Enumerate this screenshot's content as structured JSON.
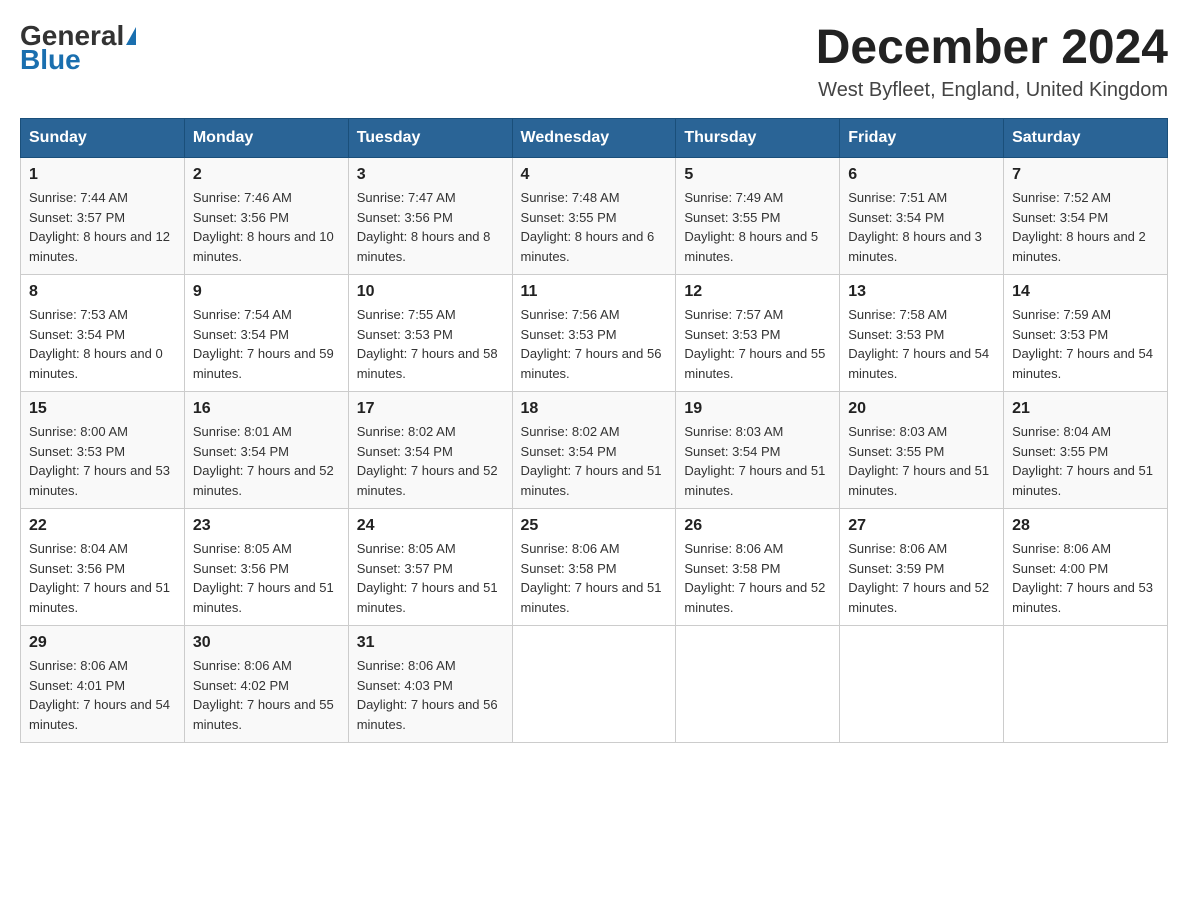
{
  "logo": {
    "general": "General",
    "blue": "Blue"
  },
  "header": {
    "month_year": "December 2024",
    "location": "West Byfleet, England, United Kingdom"
  },
  "days_of_week": [
    "Sunday",
    "Monday",
    "Tuesday",
    "Wednesday",
    "Thursday",
    "Friday",
    "Saturday"
  ],
  "weeks": [
    [
      {
        "day": "1",
        "sunrise": "7:44 AM",
        "sunset": "3:57 PM",
        "daylight": "8 hours and 12 minutes."
      },
      {
        "day": "2",
        "sunrise": "7:46 AM",
        "sunset": "3:56 PM",
        "daylight": "8 hours and 10 minutes."
      },
      {
        "day": "3",
        "sunrise": "7:47 AM",
        "sunset": "3:56 PM",
        "daylight": "8 hours and 8 minutes."
      },
      {
        "day": "4",
        "sunrise": "7:48 AM",
        "sunset": "3:55 PM",
        "daylight": "8 hours and 6 minutes."
      },
      {
        "day": "5",
        "sunrise": "7:49 AM",
        "sunset": "3:55 PM",
        "daylight": "8 hours and 5 minutes."
      },
      {
        "day": "6",
        "sunrise": "7:51 AM",
        "sunset": "3:54 PM",
        "daylight": "8 hours and 3 minutes."
      },
      {
        "day": "7",
        "sunrise": "7:52 AM",
        "sunset": "3:54 PM",
        "daylight": "8 hours and 2 minutes."
      }
    ],
    [
      {
        "day": "8",
        "sunrise": "7:53 AM",
        "sunset": "3:54 PM",
        "daylight": "8 hours and 0 minutes."
      },
      {
        "day": "9",
        "sunrise": "7:54 AM",
        "sunset": "3:54 PM",
        "daylight": "7 hours and 59 minutes."
      },
      {
        "day": "10",
        "sunrise": "7:55 AM",
        "sunset": "3:53 PM",
        "daylight": "7 hours and 58 minutes."
      },
      {
        "day": "11",
        "sunrise": "7:56 AM",
        "sunset": "3:53 PM",
        "daylight": "7 hours and 56 minutes."
      },
      {
        "day": "12",
        "sunrise": "7:57 AM",
        "sunset": "3:53 PM",
        "daylight": "7 hours and 55 minutes."
      },
      {
        "day": "13",
        "sunrise": "7:58 AM",
        "sunset": "3:53 PM",
        "daylight": "7 hours and 54 minutes."
      },
      {
        "day": "14",
        "sunrise": "7:59 AM",
        "sunset": "3:53 PM",
        "daylight": "7 hours and 54 minutes."
      }
    ],
    [
      {
        "day": "15",
        "sunrise": "8:00 AM",
        "sunset": "3:53 PM",
        "daylight": "7 hours and 53 minutes."
      },
      {
        "day": "16",
        "sunrise": "8:01 AM",
        "sunset": "3:54 PM",
        "daylight": "7 hours and 52 minutes."
      },
      {
        "day": "17",
        "sunrise": "8:02 AM",
        "sunset": "3:54 PM",
        "daylight": "7 hours and 52 minutes."
      },
      {
        "day": "18",
        "sunrise": "8:02 AM",
        "sunset": "3:54 PM",
        "daylight": "7 hours and 51 minutes."
      },
      {
        "day": "19",
        "sunrise": "8:03 AM",
        "sunset": "3:54 PM",
        "daylight": "7 hours and 51 minutes."
      },
      {
        "day": "20",
        "sunrise": "8:03 AM",
        "sunset": "3:55 PM",
        "daylight": "7 hours and 51 minutes."
      },
      {
        "day": "21",
        "sunrise": "8:04 AM",
        "sunset": "3:55 PM",
        "daylight": "7 hours and 51 minutes."
      }
    ],
    [
      {
        "day": "22",
        "sunrise": "8:04 AM",
        "sunset": "3:56 PM",
        "daylight": "7 hours and 51 minutes."
      },
      {
        "day": "23",
        "sunrise": "8:05 AM",
        "sunset": "3:56 PM",
        "daylight": "7 hours and 51 minutes."
      },
      {
        "day": "24",
        "sunrise": "8:05 AM",
        "sunset": "3:57 PM",
        "daylight": "7 hours and 51 minutes."
      },
      {
        "day": "25",
        "sunrise": "8:06 AM",
        "sunset": "3:58 PM",
        "daylight": "7 hours and 51 minutes."
      },
      {
        "day": "26",
        "sunrise": "8:06 AM",
        "sunset": "3:58 PM",
        "daylight": "7 hours and 52 minutes."
      },
      {
        "day": "27",
        "sunrise": "8:06 AM",
        "sunset": "3:59 PM",
        "daylight": "7 hours and 52 minutes."
      },
      {
        "day": "28",
        "sunrise": "8:06 AM",
        "sunset": "4:00 PM",
        "daylight": "7 hours and 53 minutes."
      }
    ],
    [
      {
        "day": "29",
        "sunrise": "8:06 AM",
        "sunset": "4:01 PM",
        "daylight": "7 hours and 54 minutes."
      },
      {
        "day": "30",
        "sunrise": "8:06 AM",
        "sunset": "4:02 PM",
        "daylight": "7 hours and 55 minutes."
      },
      {
        "day": "31",
        "sunrise": "8:06 AM",
        "sunset": "4:03 PM",
        "daylight": "7 hours and 56 minutes."
      },
      null,
      null,
      null,
      null
    ]
  ]
}
